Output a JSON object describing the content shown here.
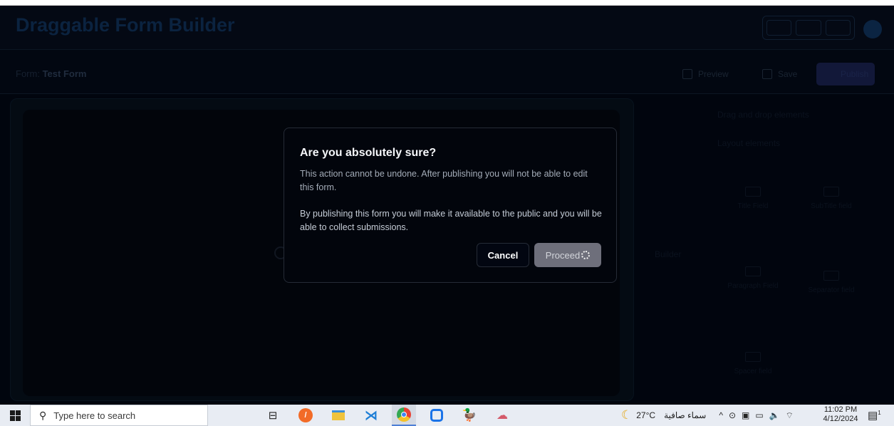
{
  "app": {
    "title": "Draggable Form Builder",
    "form_prefix": "Form:",
    "form_name": "Test Form",
    "preview_label": "Preview",
    "save_label": "Save",
    "publish_label": "Publish"
  },
  "sidebar": {
    "heading": "Drag and drop elements",
    "section": "Layout elements",
    "layout_label": "Builder",
    "elements": [
      {
        "label": "Title Field"
      },
      {
        "label": "SubTitle field"
      },
      {
        "label": "Paragraph Field"
      },
      {
        "label": "Separator field"
      },
      {
        "label": "Spacer field"
      }
    ]
  },
  "dialog": {
    "title": "Are you absolutely sure?",
    "description": "This action cannot be undone. After publishing you will not be able to edit this form.",
    "note": "By publishing this form you will make it available to the public and you will be able to collect submissions.",
    "cancel_label": "Cancel",
    "proceed_label": "Proceed"
  },
  "taskbar": {
    "search_placeholder": "Type here to search",
    "weather_temp": "27°C",
    "weather_text": "سماء صافية",
    "time": "11:02 PM",
    "date": "4/12/2024",
    "notification_count": "1",
    "apps": [
      "task-view-icon",
      "brave-browser-icon",
      "file-explorer-icon",
      "vscode-icon",
      "chrome-icon",
      "app-blue-icon",
      "duck-app-icon",
      "brain-app-icon"
    ]
  }
}
